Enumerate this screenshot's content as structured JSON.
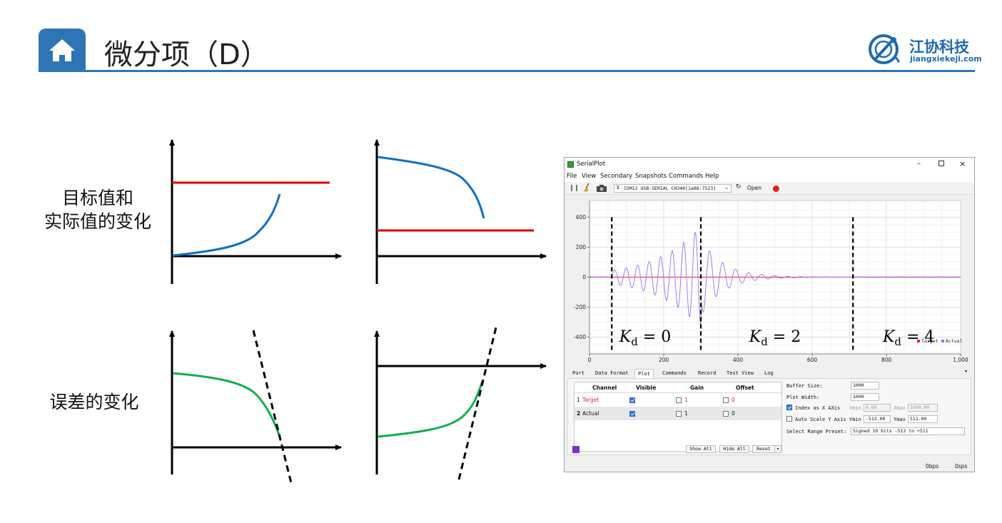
{
  "header": {
    "title": "微分项（D）",
    "logo_name": "江协科技",
    "logo_url": "jiangxiekeji.com",
    "accent": "#2e75b6"
  },
  "labels": {
    "row1_line1": "目标值和",
    "row1_line2": "实际值的变化",
    "row2": "误差的变化"
  },
  "sketch_colors": {
    "target": "#e00000",
    "actual": "#1070c0",
    "error": "#10b050"
  },
  "serialplot": {
    "title": "SerialPlot",
    "menu": [
      "File",
      "View",
      "Secondary",
      "Snapshots",
      "Commands",
      "Help"
    ],
    "port": "COM12 USB-SERIAL CH340[1a86:7523]",
    "open_button": "Open",
    "chart": {
      "type": "line",
      "y_ticks": [
        "400",
        "200",
        "0",
        "-200",
        "-400"
      ],
      "x_ticks": [
        "0",
        "200",
        "400",
        "600",
        "800",
        "1,000"
      ],
      "xlim": [
        0,
        1000
      ],
      "ylim": [
        -512,
        511
      ],
      "legend": [
        "Target",
        "Actual"
      ],
      "legend_colors": [
        "#e02060",
        "#a070e0"
      ],
      "annotations": [
        {
          "text_var": "K",
          "text_sub": "d",
          "text_eq": " = 0"
        },
        {
          "text_var": "K",
          "text_sub": "d",
          "text_eq": " = 2"
        },
        {
          "text_var": "K",
          "text_sub": "d",
          "text_eq": " = 4"
        }
      ],
      "dividers_x": [
        60,
        300,
        710
      ]
    },
    "tabs": [
      "Port",
      "Data Format",
      "Plot",
      "Commands",
      "Record",
      "Text View",
      "Log"
    ],
    "active_tab": "Plot",
    "table": {
      "headers": [
        "Channel",
        "Visible",
        "Gain",
        "Offset"
      ],
      "rows": [
        {
          "index": "1",
          "name": "Target",
          "gain": "1",
          "offset": "0",
          "color": "#e02060"
        },
        {
          "index": "2",
          "name": "Actual",
          "gain": "1",
          "offset": "0",
          "color": "#111111"
        }
      ],
      "buttons": [
        "Show All",
        "Hide All",
        "Reset"
      ]
    },
    "settings": {
      "buffer_size_label": "Buffer Size:",
      "buffer_size": "1000",
      "plot_width_label": "Plot Width:",
      "plot_width": "1000",
      "index_x_label": "Index as X AXis",
      "xmin_label": "Xmin",
      "xmin": "0.00",
      "xmax_label": "Xmax",
      "xmax": "1000.00",
      "auto_scale_label": "Auto Scale Y Axis",
      "ymin_label": "Ymin",
      "ymin": "-512.00",
      "ymax_label": "Ymax",
      "ymax": "511.00",
      "preset_label": "Select Range Preset:",
      "preset": "Signed 10 bits -512 to +511"
    },
    "status": {
      "bps": "0bps",
      "sps": "0sps"
    }
  }
}
